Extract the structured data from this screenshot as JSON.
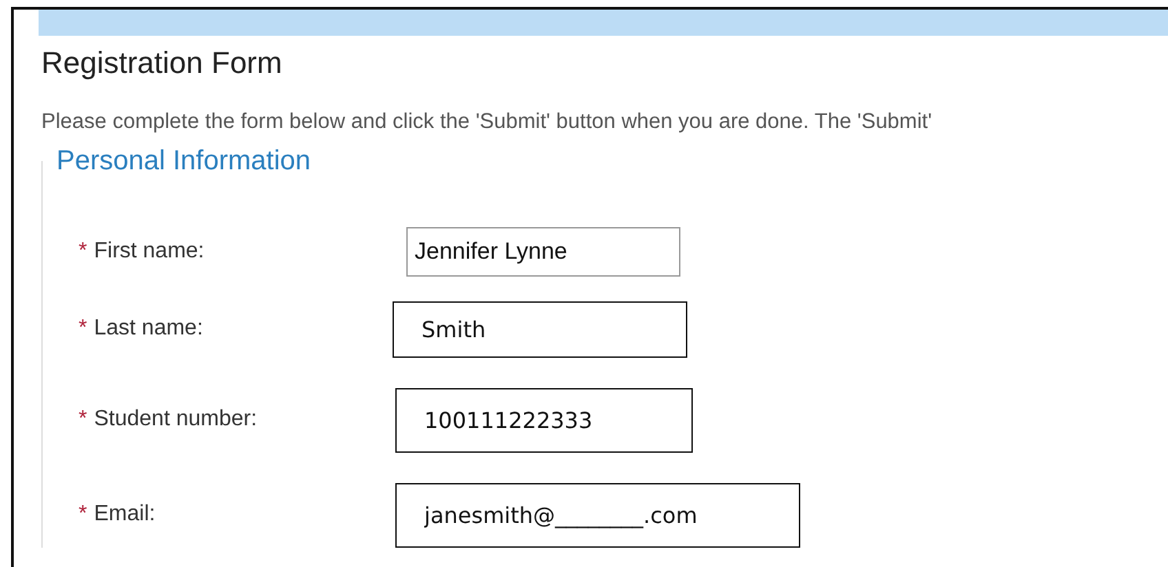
{
  "title": "Registration Form",
  "intro": "Please complete the form below and click the 'Submit' button when you are done. The 'Submit'",
  "section": {
    "legend": "Personal Information",
    "fields": [
      {
        "label": "First name:",
        "required_mark": "*",
        "value": "Jennifer Lynne",
        "kind": "native"
      },
      {
        "label": "Last name:",
        "required_mark": "*",
        "value": "Smith",
        "kind": "overlay"
      },
      {
        "label": "Student number:",
        "required_mark": "*",
        "value": "100111222333",
        "kind": "overlay"
      },
      {
        "label": "Email:",
        "required_mark": "*",
        "value": "janesmith@________.com",
        "kind": "overlay"
      }
    ]
  }
}
